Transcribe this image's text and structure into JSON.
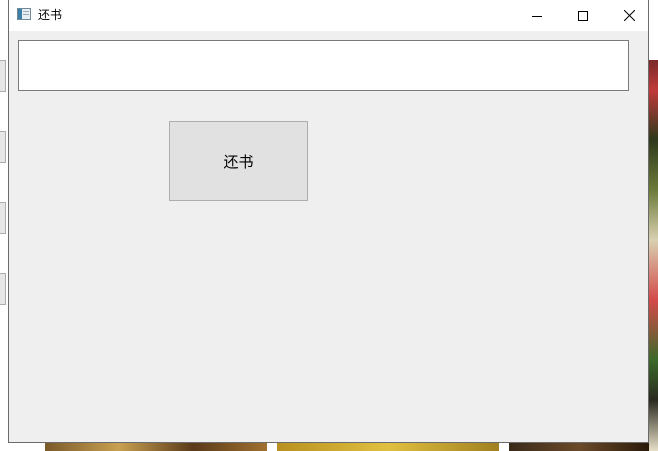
{
  "window": {
    "title": "还书",
    "icon": "app-window-icon",
    "controls": [
      "minimize-icon",
      "maximize-icon",
      "close-icon"
    ]
  },
  "form": {
    "input_value": "",
    "input_placeholder": "",
    "return_button_label": "还书"
  },
  "colors": {
    "window_bg": "#efefef",
    "titlebar_bg": "#ffffff",
    "button_bg": "#e1e1e1",
    "button_border": "#adadad",
    "input_border": "#7a7a7a"
  }
}
